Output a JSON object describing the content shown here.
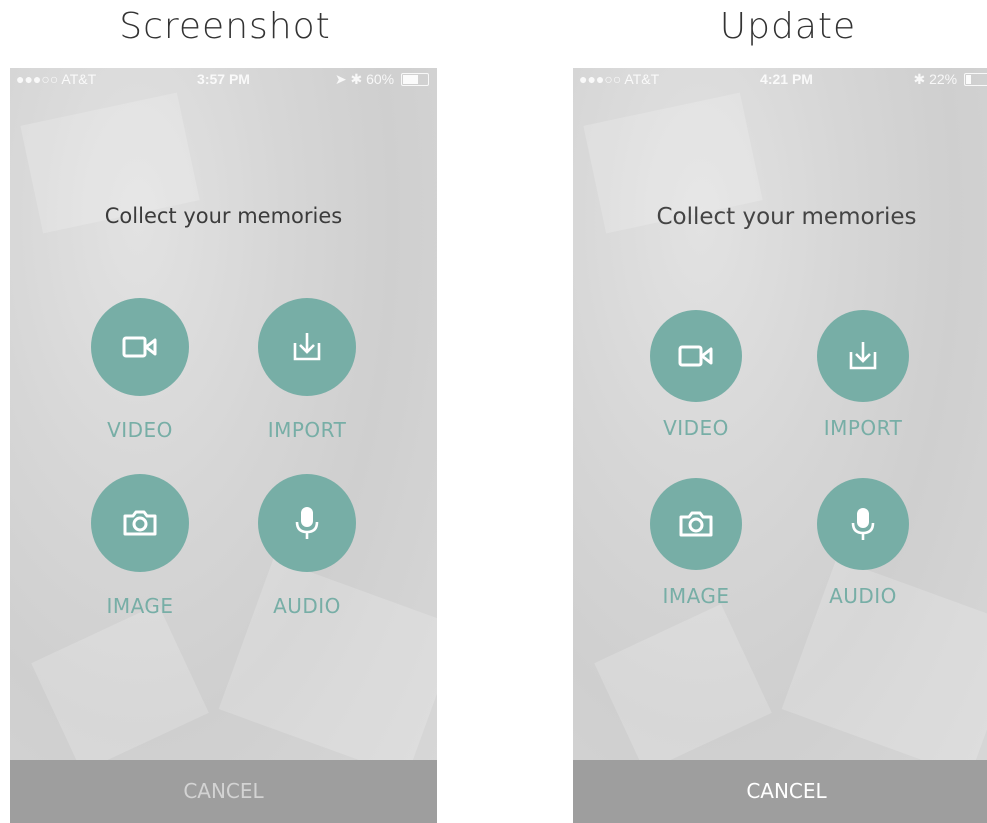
{
  "left": {
    "heading": "Screenshot",
    "status": {
      "carrier": "●●●○○ AT&T",
      "time": "3:57 PM",
      "battery": "60%",
      "battery_level": 0.6
    },
    "headline": "Collect your memories",
    "actions": {
      "video": "VIDEO",
      "import": "IMPORT",
      "image": "IMAGE",
      "audio": "AUDIO"
    },
    "cancel": "CANCEL"
  },
  "right": {
    "heading": "Update",
    "status": {
      "carrier": "●●●○○ AT&T",
      "time": "4:21 PM",
      "battery": "22%",
      "battery_level": 0.22
    },
    "headline": "Collect your memories",
    "actions": {
      "video": "VIDEO",
      "import": "IMPORT",
      "image": "IMAGE",
      "audio": "AUDIO"
    },
    "cancel": "CANCEL"
  },
  "icons": {
    "video": "video-camera-icon",
    "import": "import-download-icon",
    "image": "camera-icon",
    "audio": "microphone-icon"
  },
  "colors": {
    "accent": "#77aea6",
    "cancel_bar": "#9e9e9e",
    "background": "#d6d6d6"
  }
}
